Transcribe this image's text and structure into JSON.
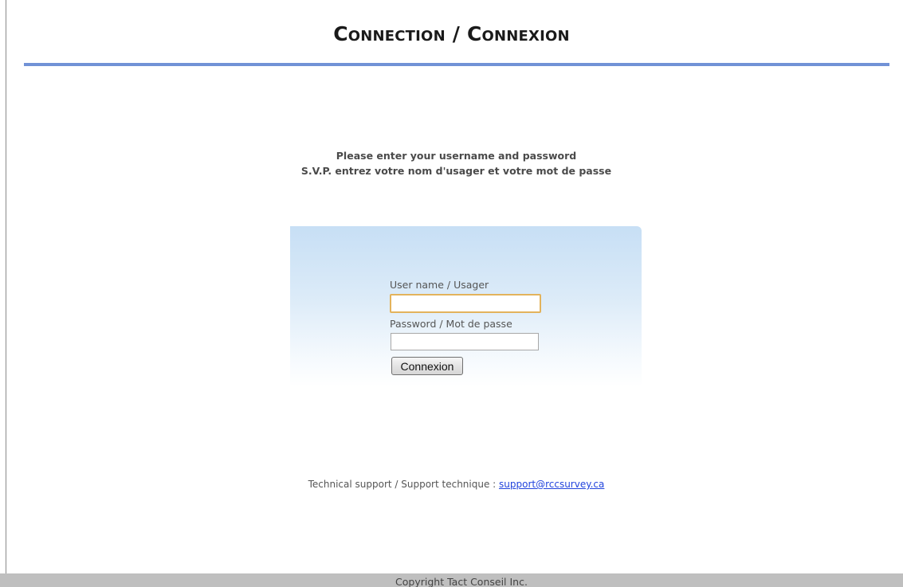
{
  "header": {
    "title": "Connection / Connexion"
  },
  "instructions": {
    "line_en": "Please enter your username and password",
    "line_fr": "S.V.P. entrez votre nom d'usager et votre mot de passe"
  },
  "login_form": {
    "username_label": "User name / Usager",
    "username_value": "",
    "password_label": "Password / Mot de passe",
    "password_value": "",
    "submit_label": "Connexion"
  },
  "support": {
    "label": "Technical support / Support technique : ",
    "email": "support@rccsurvey.ca"
  },
  "footer": {
    "copyright": "Copyright Tact Conseil Inc."
  },
  "colors": {
    "title_rule": "#7192d6",
    "panel_gradient_top": "#c7dff5",
    "focused_input_border": "#e3b35c",
    "link": "#2244dd",
    "footer_bar": "#bfbfbf"
  }
}
